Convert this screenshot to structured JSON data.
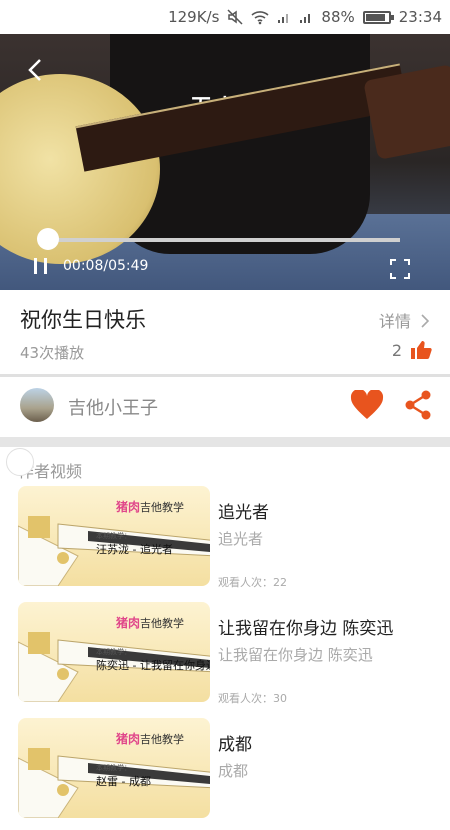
{
  "status_bar": {
    "speed": "129K/s",
    "battery_percent": "88%",
    "battery_level": 0.88,
    "time": "23:34"
  },
  "player": {
    "shirt_text": "无止境",
    "time_display": "00:08/05:49",
    "progress": 0.023,
    "accent_color": "#e53935"
  },
  "video_info": {
    "title": "祝你生日快乐",
    "detail_label": "详情",
    "play_count": "43次播放",
    "like_count": "2"
  },
  "author": {
    "name": "吉他小王子",
    "accent_color": "#e8541e"
  },
  "author_videos": {
    "section_title": "作者视频",
    "items": [
      {
        "thumb_brand": "猪肉",
        "thumb_brand_suffix": "吉他教学",
        "thumb_sub": "本期教学：",
        "thumb_song": "汪苏泷 - 追光者",
        "title": "追光者",
        "subtitle": "追光者",
        "views": "观看人次：22"
      },
      {
        "thumb_brand": "猪肉",
        "thumb_brand_suffix": "吉他教学",
        "thumb_sub": "本期教学：",
        "thumb_song": "陈奕迅 - 让我留在你身边",
        "title": "让我留在你身边 陈奕迅",
        "subtitle": "让我留在你身边 陈奕迅",
        "views": "观看人次：30"
      },
      {
        "thumb_brand": "猪肉",
        "thumb_brand_suffix": "吉他教学",
        "thumb_sub": "本期教学：",
        "thumb_song": "赵雷 - 成都",
        "title": "成都",
        "subtitle": "成都",
        "views": ""
      }
    ]
  }
}
